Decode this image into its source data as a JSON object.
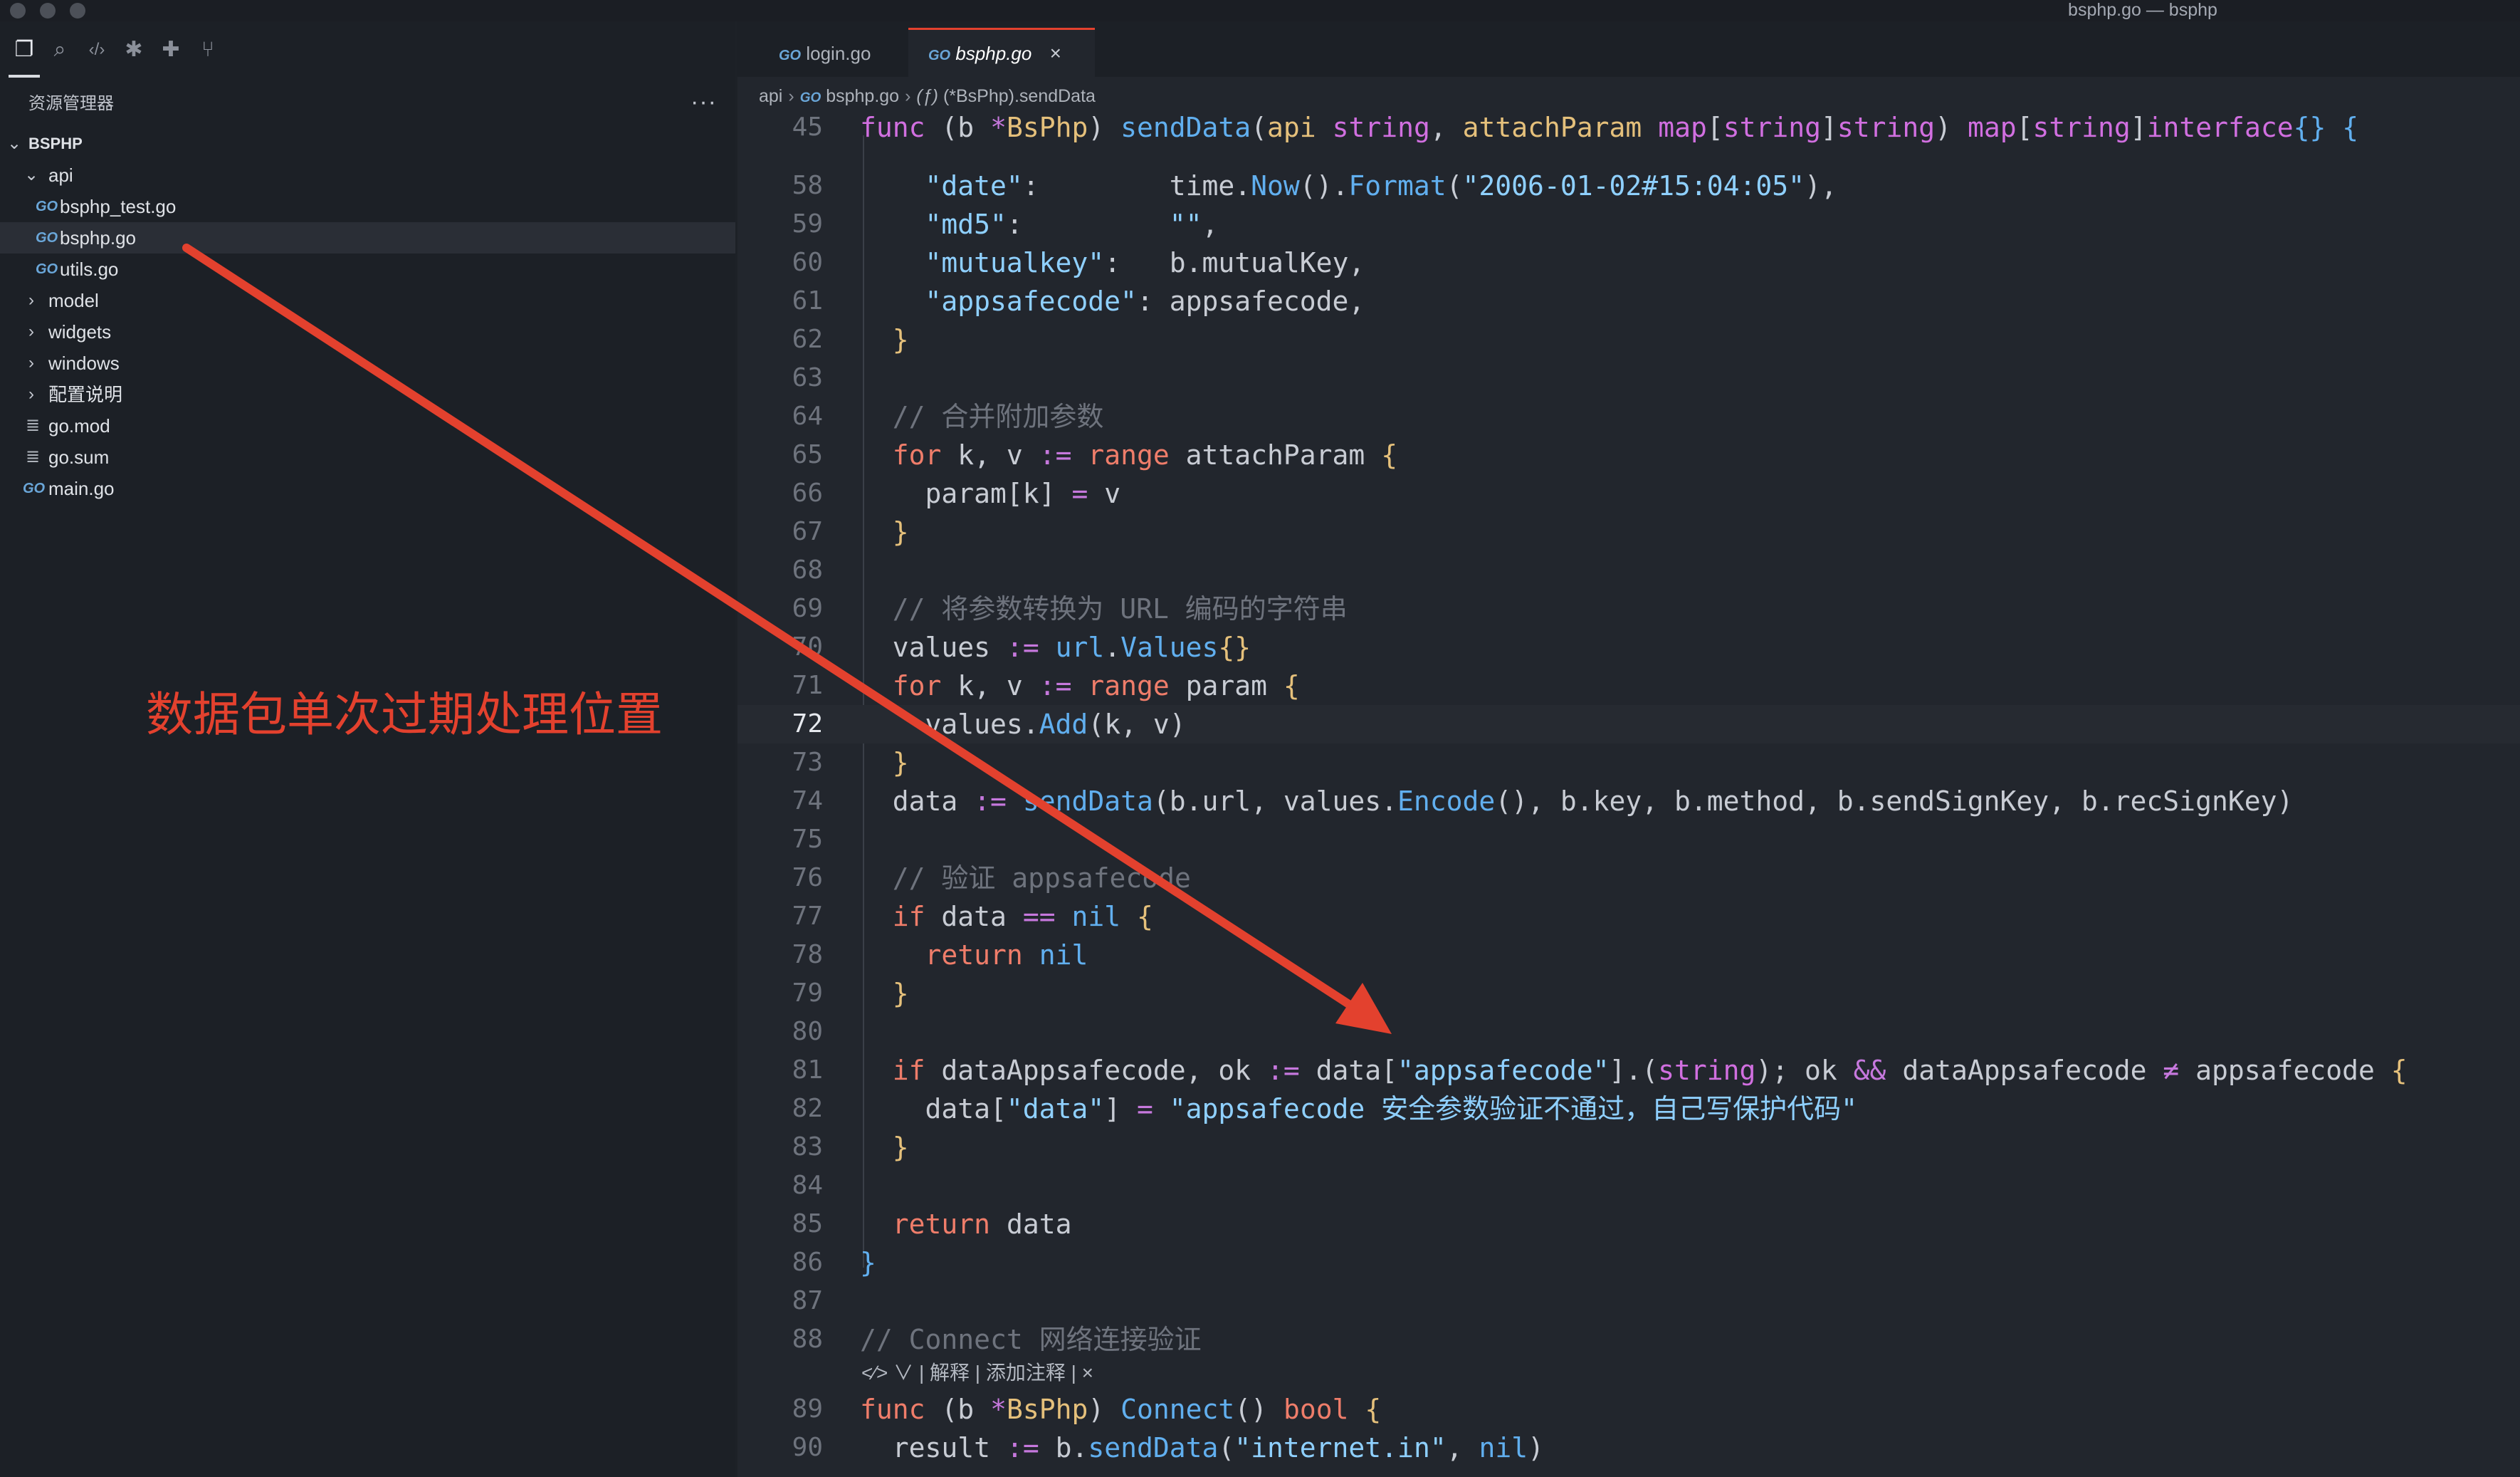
{
  "window": {
    "title": "bsphp.go — bsphp"
  },
  "sidebar": {
    "title": "资源管理器",
    "more_label": "···",
    "tree": [
      {
        "label": "BSPHP",
        "kind": "root",
        "level": 0
      },
      {
        "label": "api",
        "kind": "folder-open",
        "level": 1
      },
      {
        "label": "bsphp_test.go",
        "kind": "go",
        "level": 2
      },
      {
        "label": "bsphp.go",
        "kind": "go",
        "level": 2,
        "selected": true
      },
      {
        "label": "utils.go",
        "kind": "go",
        "level": 2
      },
      {
        "label": "model",
        "kind": "folder",
        "level": 1
      },
      {
        "label": "widgets",
        "kind": "folder",
        "level": 1
      },
      {
        "label": "windows",
        "kind": "folder",
        "level": 1
      },
      {
        "label": "配置说明",
        "kind": "folder",
        "level": 1
      },
      {
        "label": "go.mod",
        "kind": "doc",
        "level": 1
      },
      {
        "label": "go.sum",
        "kind": "doc",
        "level": 1
      },
      {
        "label": "main.go",
        "kind": "go",
        "level": 1
      }
    ]
  },
  "annotation": {
    "text": "数据包单次过期处理位置",
    "color": "#e3412e"
  },
  "tabs": [
    {
      "label": "login.go",
      "active": false
    },
    {
      "label": "bsphp.go",
      "active": true,
      "close": "×"
    }
  ],
  "breadcrumb": {
    "folder": "api",
    "file": "bsphp.go",
    "symbol": "(*BsPhp).sendData"
  },
  "codelens": {
    "text": "<∕> ∨ | 解释 | 添加注释 | ×"
  },
  "current_line": "72",
  "code_lines": [
    {
      "n": "45",
      "html": "<span class=\"kw\">func</span> <span class=\"pl\">(b</span> <span class=\"op\">*</span><span class=\"ty\">BsPhp</span><span class=\"pl\">)</span> <span class=\"fn\">sendData</span><span class=\"pl\">(</span><span class=\"ty\">api</span> <span class=\"kw\">string</span><span class=\"pl\">,</span> <span class=\"ty\">attachParam</span> <span class=\"kw\">map</span><span class=\"pl\">[</span><span class=\"kw\">string</span><span class=\"pl\">]</span><span class=\"kw\">string</span><span class=\"pl\">)</span> <span class=\"kw\">map</span><span class=\"pl\">[</span><span class=\"kw\">string</span><span class=\"pl\">]</span><span class=\"kw\">interface</span><span class=\"fn\">{}</span> <span class=\"fn\">{</span>"
    },
    {
      "n": "58",
      "html": "    <span class=\"strb\">\"date\"</span><span class=\"pl\">:        time.</span><span class=\"fn\">Now</span><span class=\"pl\">().</span><span class=\"fn\">Format</span><span class=\"pl\">(</span><span class=\"strb\">\"2006-01-02#15:04:05\"</span><span class=\"pl\">),</span>"
    },
    {
      "n": "59",
      "html": "    <span class=\"strb\">\"md5\"</span><span class=\"pl\">:         </span><span class=\"strb\">\"\"</span><span class=\"pl\">,</span>"
    },
    {
      "n": "60",
      "html": "    <span class=\"strb\">\"mutualkey\"</span><span class=\"pl\">:   b.mutualKey,</span>"
    },
    {
      "n": "61",
      "html": "    <span class=\"strb\">\"appsafecode\"</span><span class=\"pl\">: appsafecode,</span>"
    },
    {
      "n": "62",
      "html": "  <span class=\"br\">}</span>"
    },
    {
      "n": "63",
      "html": ""
    },
    {
      "n": "64",
      "html": "  <span class=\"cm\">// 合并附加参数</span>"
    },
    {
      "n": "65",
      "html": "  <span class=\"kw2\">for</span> <span class=\"pl\">k, v</span> <span class=\"op\">:=</span> <span class=\"kw2\">range</span> <span class=\"pl\">attachParam</span> <span class=\"br\">{</span>"
    },
    {
      "n": "66",
      "html": "    <span class=\"pl\">param[k]</span> <span class=\"op\">=</span> <span class=\"pl\">v</span>"
    },
    {
      "n": "67",
      "html": "  <span class=\"br\">}</span>"
    },
    {
      "n": "68",
      "html": ""
    },
    {
      "n": "69",
      "html": "  <span class=\"cm\">// 将参数转换为 URL 编码的字符串</span>"
    },
    {
      "n": "70",
      "html": "  <span class=\"pl\">values</span> <span class=\"op\">:=</span> <span class=\"fn\">url</span><span class=\"pl\">.</span><span class=\"fn\">Values</span><span class=\"br\">{}</span>"
    },
    {
      "n": "71",
      "html": "  <span class=\"kw2\">for</span> <span class=\"pl\">k, v</span> <span class=\"op\">:=</span> <span class=\"kw2\">range</span> <span class=\"pl\">param</span> <span class=\"br\">{</span>"
    },
    {
      "n": "72",
      "html": "    <span class=\"pl\">values.</span><span class=\"fn\">Add</span><span class=\"pl\">(k, v)</span>"
    },
    {
      "n": "73",
      "html": "  <span class=\"br\">}</span>"
    },
    {
      "n": "74",
      "html": "  <span class=\"pl\">data</span> <span class=\"op\">:=</span> <span class=\"fn\">sendData</span><span class=\"pl\">(b.url, values.</span><span class=\"fn\">Encode</span><span class=\"pl\">(), b.key, b.method, b.sendSignKey, b.recSignKey)</span>"
    },
    {
      "n": "75",
      "html": ""
    },
    {
      "n": "76",
      "html": "  <span class=\"cm\">// 验证 appsafecode</span>"
    },
    {
      "n": "77",
      "html": "  <span class=\"kw2\">if</span> <span class=\"pl\">data</span> <span class=\"op\">==</span> <span class=\"fn\">nil</span> <span class=\"br\">{</span>"
    },
    {
      "n": "78",
      "html": "    <span class=\"kw2\">return</span> <span class=\"fn\">nil</span>"
    },
    {
      "n": "79",
      "html": "  <span class=\"br\">}</span>"
    },
    {
      "n": "80",
      "html": ""
    },
    {
      "n": "81",
      "html": "  <span class=\"kw2\">if</span> <span class=\"pl\">dataAppsafecode, ok</span> <span class=\"op\">:=</span> <span class=\"pl\">data[</span><span class=\"strb\">\"appsafecode\"</span><span class=\"pl\">].(</span><span class=\"kw\">string</span><span class=\"pl\">); ok</span> <span class=\"op\">&amp;&amp;</span> <span class=\"pl\">dataAppsafecode</span> <span class=\"op\">≠</span> <span class=\"pl\">appsafecode</span> <span class=\"br\">{</span>"
    },
    {
      "n": "82",
      "html": "    <span class=\"pl\">data[</span><span class=\"strb\">\"data\"</span><span class=\"pl\">]</span> <span class=\"op\">=</span> <span class=\"strb\">\"appsafecode 安全参数验证不通过，自己写保护代码\"</span>"
    },
    {
      "n": "83",
      "html": "  <span class=\"br\">}</span>"
    },
    {
      "n": "84",
      "html": ""
    },
    {
      "n": "85",
      "html": "  <span class=\"kw2\">return</span> <span class=\"pl\">data</span>"
    },
    {
      "n": "86",
      "html": "<span class=\"fn\">}</span>"
    },
    {
      "n": "87",
      "html": ""
    },
    {
      "n": "88",
      "html": "<span class=\"cm\">// Connect 网络连接验证</span>"
    },
    {
      "n": "89",
      "html": "<span class=\"kw2\">func</span> <span class=\"pl\">(b</span> <span class=\"op\">*</span><span class=\"ty\">BsPhp</span><span class=\"pl\">)</span> <span class=\"fn\">Connect</span><span class=\"pl\">()</span> <span class=\"kw2\">bool</span> <span class=\"br\">{</span>"
    },
    {
      "n": "90",
      "html": "  <span class=\"pl\">result</span> <span class=\"op\">:=</span> <span class=\"pl\">b.</span><span class=\"fn\">sendData</span><span class=\"pl\">(</span><span class=\"strb\">\"internet.in\"</span><span class=\"pl\">,</span> <span class=\"fn\">nil</span><span class=\"pl\">)</span>"
    }
  ]
}
